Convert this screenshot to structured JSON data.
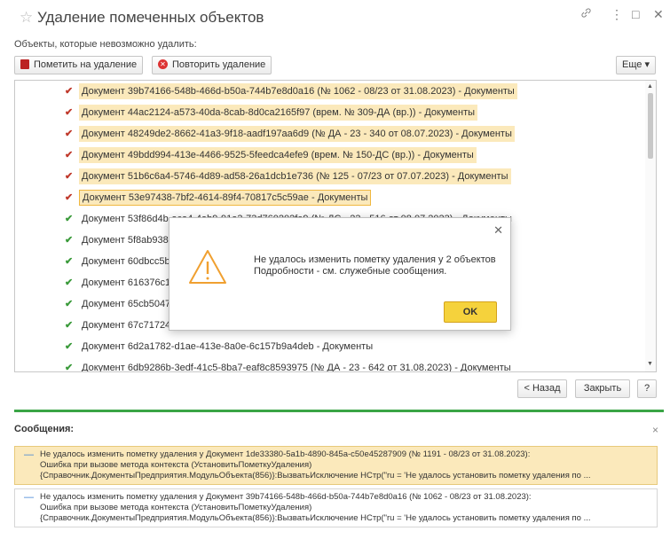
{
  "window": {
    "title": "Удаление помеченных объектов",
    "subtitle": "Объекты, которые невозможно удалить:"
  },
  "toolbar": {
    "mark_label": "Пометить на удаление",
    "retry_label": "Повторить удаление",
    "more_label": "Еще ▾"
  },
  "list": {
    "rows": [
      {
        "text": "Документ 39b74166-548b-466d-b50a-744b7e8d0a16 (№ 1062 - 08/23 от 31.08.2023) - Документы",
        "status": "red",
        "highlight": "hl"
      },
      {
        "text": "Документ 44ac2124-a573-40da-8cab-8d0ca2165f97 (врем. № 309-ДА (вр.)) - Документы",
        "status": "red",
        "highlight": "hl"
      },
      {
        "text": "Документ 48249de2-8662-41a3-9f18-aadf197aa6d9 (№ ДА - 23 - 340 от 08.07.2023) - Документы",
        "status": "red",
        "highlight": "hl"
      },
      {
        "text": "Документ 49bdd994-413e-4466-9525-5feedca4efe9 (врем. № 150-ДС (вр.)) - Документы",
        "status": "red",
        "highlight": "hl"
      },
      {
        "text": "Документ 51b6c6a4-5746-4d89-ad58-26a1dcb1e736 (№ 125 - 07/23 от 07.07.2023) - Документы",
        "status": "red",
        "highlight": "hl"
      },
      {
        "text": "Документ 53e97438-7bf2-4614-89f4-70817c5c59ae - Документы",
        "status": "red",
        "highlight": "sel"
      },
      {
        "text": "Документ 53f86d4b-aca4-4ab9-91a3-73d760202fe9 (№ ДС - 23 - 516 от 08.07.2023) - Документы",
        "status": "green",
        "highlight": ""
      },
      {
        "text": "Документ 5f8ab938-",
        "status": "green",
        "highlight": ""
      },
      {
        "text": "Документ 60dbcc5b",
        "status": "green",
        "highlight": ""
      },
      {
        "text": "Документ 616376c1-",
        "status": "green",
        "highlight": ""
      },
      {
        "text": "Документ 65cb5047",
        "status": "green",
        "highlight": ""
      },
      {
        "text": "Документ 67c71724",
        "status": "green",
        "highlight": ""
      },
      {
        "text": "Документ 6d2a1782-d1ae-413e-8a0e-6c157b9a4deb - Документы",
        "status": "green",
        "highlight": ""
      },
      {
        "text": "Документ 6db9286b-3edf-41c5-8ba7-eaf8c8593975 (№ ДА - 23 - 642 от 31.08.2023) - Документы",
        "status": "green",
        "highlight": ""
      }
    ]
  },
  "dialog": {
    "message_line1": "Не удалось изменить пометку удаления у 2 объектов",
    "message_line2": "Подробности - см. служебные сообщения.",
    "ok_label": "OK"
  },
  "nav": {
    "back_label": "< Назад",
    "close_label": "Закрыть",
    "help_label": "?"
  },
  "messages": {
    "title": "Сообщения:",
    "items": [
      {
        "line1": "Не удалось изменить пометку удаления у Документ 1de33380-5a1b-4890-845a-c50e45287909 (№ 1191 - 08/23 от 31.08.2023):",
        "line2": "Ошибка при вызове метода контекста (УстановитьПометкуУдаления)",
        "line3": "{Справочник.ДокументыПредприятия.МодульОбъекта(856)}:ВызватьИсключение НСтр(\"ru = 'Не удалось установить пометку удаления по ..."
      },
      {
        "line1": "Не удалось изменить пометку удаления у Документ 39b74166-548b-466d-b50a-744b7e8d0a16 (№ 1062 - 08/23 от 31.08.2023):",
        "line2": "Ошибка при вызове метода контекста (УстановитьПометкуУдаления)",
        "line3": "{Справочник.ДокументыПредприятия.МодульОбъекта(856)}:ВызватьИсключение НСтр(\"ru = 'Не удалось установить пометку удаления по ..."
      }
    ]
  },
  "colors": {
    "highlight": "#fbe9bb",
    "accent_green": "#3aa546",
    "ok_yellow": "#f5d23c",
    "warning_orange": "#f0a030"
  }
}
